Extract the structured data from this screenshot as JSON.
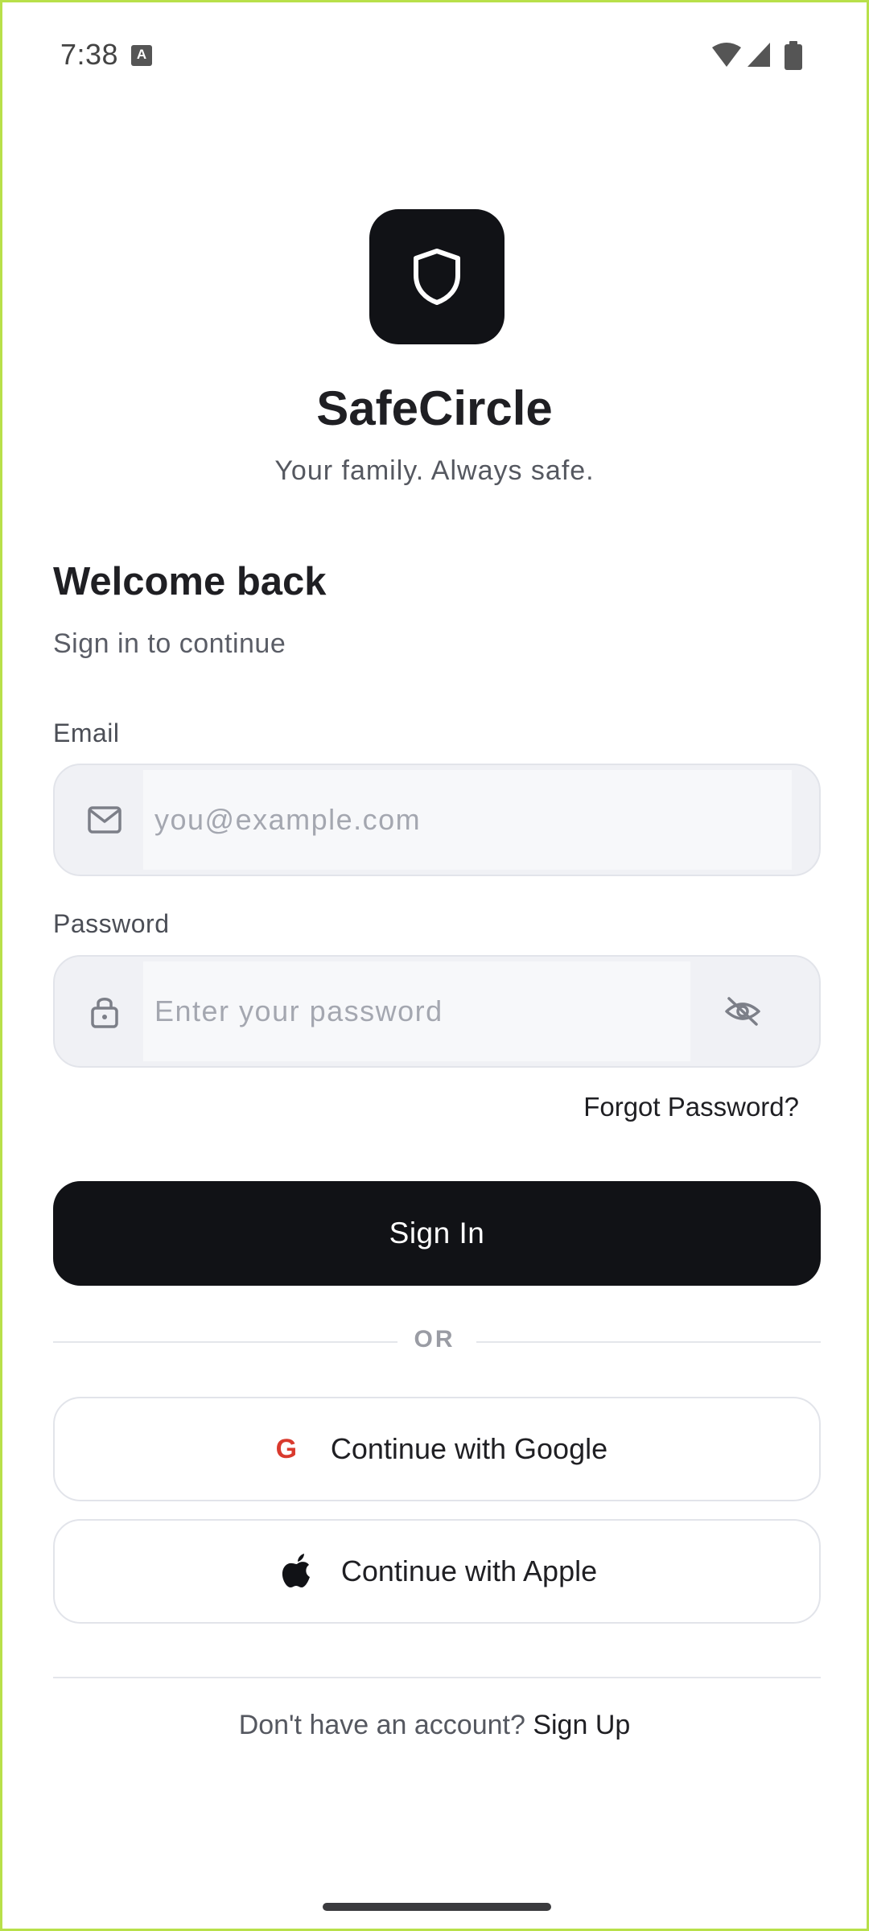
{
  "status_bar": {
    "time": "7:38",
    "notification_icon": "a-letter-icon",
    "right_icons": [
      "wifi-icon",
      "cell-signal-icon",
      "battery-icon"
    ]
  },
  "app": {
    "logo_icon": "shield-icon",
    "name": "SafeCircle",
    "tagline": "Your family. Always safe."
  },
  "form": {
    "heading": "Welcome back",
    "subheading": "Sign in to continue",
    "email": {
      "label": "Email",
      "value": "",
      "placeholder": "you@example.com",
      "icon": "mail-icon"
    },
    "password": {
      "label": "Password",
      "value": "",
      "placeholder": "Enter your password",
      "icon": "lock-icon",
      "toggle_icon": "eye-off-icon"
    },
    "forgot_label": "Forgot Password?",
    "signin_label": "Sign In"
  },
  "separator": {
    "label": "OR"
  },
  "social": {
    "google_label": "Continue with Google",
    "google_icon_glyph": "G",
    "apple_label": "Continue with Apple"
  },
  "footer": {
    "prompt": "Don't have an account?",
    "link": "Sign Up"
  },
  "colors": {
    "primary": "#111216",
    "google_red": "#d93a2e",
    "field_bg": "#f0f1f5"
  }
}
